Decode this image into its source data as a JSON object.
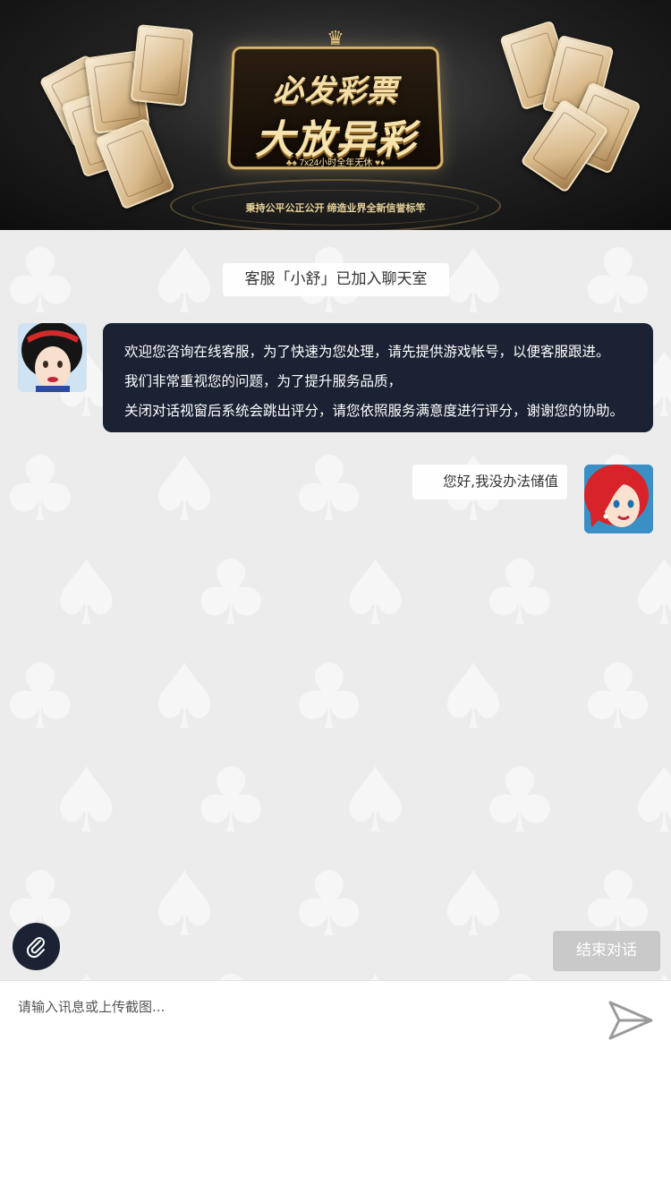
{
  "banner": {
    "brand_line1": "必发彩票",
    "brand_line2": "大放异彩",
    "service_hours": "7x24小时全年无休",
    "tagline": "秉持公平公正公开 缔造业界全新信誉标竿"
  },
  "chat": {
    "system_message": "客服「小舒」已加入聊天室",
    "agent_message": {
      "lines": [
        "欢迎您咨询在线客服，为了快速为您处理，请先提供游戏帐号，以便客服跟进。",
        "我们非常重视您的问题，为了提升服务品质，",
        "关闭对话视窗后系统会跳出评分，请您依照服务满意度进行评分，谢谢您的协助。"
      ]
    },
    "user_message": "您好,我没办法储值",
    "end_button_label": "结束对话"
  },
  "input": {
    "placeholder": "请输入讯息或上传截图..."
  },
  "icons": {
    "attach": "paperclip-icon",
    "send": "send-arrow-icon"
  },
  "colors": {
    "dark_accent": "#1a2233",
    "end_button_bg": "#c9c9c9",
    "chat_bg": "#ececec",
    "gold": "#e6c47a"
  }
}
